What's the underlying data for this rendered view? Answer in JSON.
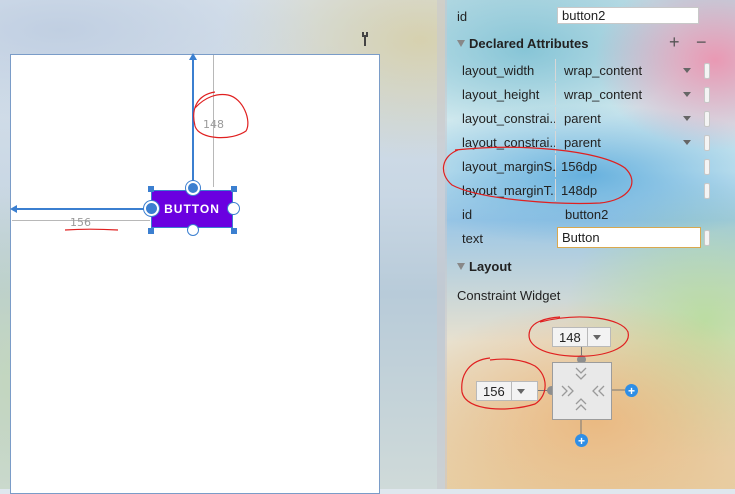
{
  "panel": {
    "id_label": "id",
    "id_value": "button2",
    "declared_title": "Declared Attributes",
    "add_symbol": "+",
    "remove_symbol": "−",
    "attributes": [
      {
        "name": "layout_width",
        "value": "wrap_content"
      },
      {
        "name": "layout_height",
        "value": "wrap_content"
      },
      {
        "name": "layout_constrai...",
        "value": "parent"
      },
      {
        "name": "layout_constrai...",
        "value": "parent"
      },
      {
        "name": "layout_marginS...",
        "value": "156dp"
      },
      {
        "name": "layout_marginT...",
        "value": "148dp"
      },
      {
        "name": "id",
        "value": "button2"
      },
      {
        "name": "text",
        "value": "Button"
      }
    ],
    "layout_title": "Layout",
    "constraint_widget_label": "Constraint Widget",
    "top_margin": "148",
    "start_margin": "156"
  },
  "canvas": {
    "button_text": "BUTTON",
    "top_dim": "148",
    "start_dim": "156"
  },
  "colors": {
    "button": "#6a00e0",
    "constraint": "#3b7fd0",
    "annotation": "#e02020"
  }
}
